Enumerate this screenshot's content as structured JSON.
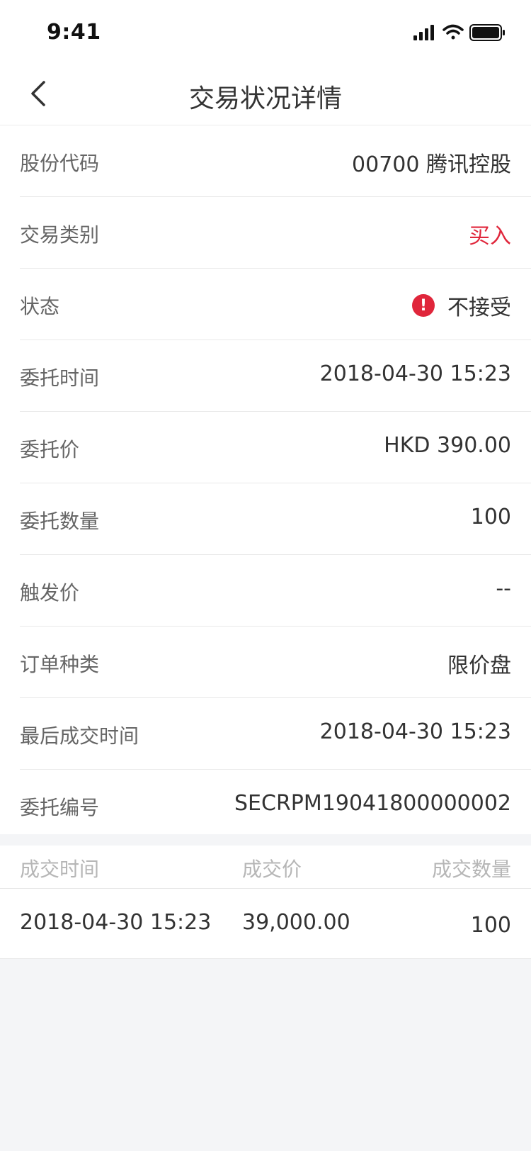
{
  "status_bar": {
    "time": "9:41"
  },
  "nav": {
    "title": "交易状况详情"
  },
  "details": [
    {
      "label": "股份代码",
      "value": "00700 腾讯控股"
    },
    {
      "label": "交易类别",
      "value": "买入",
      "color": "#e0263b"
    },
    {
      "label": "状态",
      "value": "不接受",
      "icon": "alert-icon"
    },
    {
      "label": "委托时间",
      "value": "2018-04-30 15:23"
    },
    {
      "label": "委托价",
      "value": "HKD 390.00"
    },
    {
      "label": "委托数量",
      "value": "100"
    },
    {
      "label": "触发价",
      "value": "--"
    },
    {
      "label": "订单种类",
      "value": "限价盘"
    },
    {
      "label": "最后成交时间",
      "value": "2018-04-30 15:23"
    },
    {
      "label": "委托编号",
      "value": "SECRPM19041800000002"
    }
  ],
  "trades": {
    "headers": [
      "成交时间",
      "成交价",
      "成交数量"
    ],
    "rows": [
      [
        "2018-04-30 15:23",
        "39,000.00",
        "100"
      ]
    ]
  },
  "colors": {
    "accent_red": "#e0263b",
    "background": "#f4f5f7"
  }
}
